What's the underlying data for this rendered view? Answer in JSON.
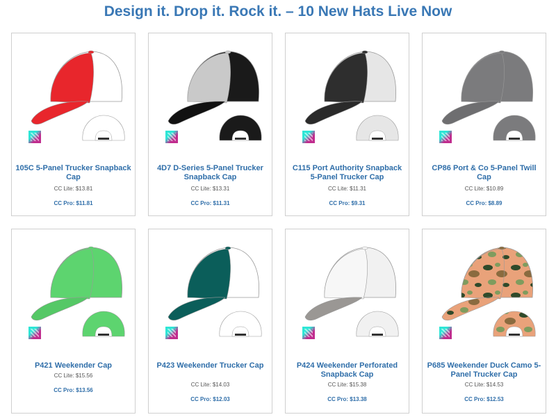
{
  "page": {
    "title": "Design it. Drop it. Rock it. – 10 New Hats Live Now"
  },
  "products": [
    {
      "name": "105C 5-Panel Trucker Snapback Cap",
      "lite": "CC Lite: $13.81",
      "pro": "CC Pro: $11.81",
      "front_color": "#e8262c",
      "mesh_color": "#ffffff",
      "brim_color": "#e8262c"
    },
    {
      "name": "4D7 D-Series 5-Panel Trucker Snapback Cap",
      "lite": "CC Lite: $13.31",
      "pro": "CC Pro: $11.31",
      "front_color": "#c9c9c9",
      "mesh_color": "#1a1a1a",
      "brim_color": "#111111"
    },
    {
      "name": "C115 Port Authority Snapback 5-Panel Trucker Cap",
      "lite": "CC Lite: $11.31",
      "pro": "CC Pro: $9.31",
      "front_color": "#2e2e2e",
      "mesh_color": "#e6e6e6",
      "brim_color": "#2a2a2a"
    },
    {
      "name": "CP86 Port & Co 5-Panel Twill Cap",
      "lite": "CC Lite: $10.89",
      "pro": "CC Pro: $8.89",
      "front_color": "#7b7b7d",
      "mesh_color": "#7b7b7d",
      "brim_color": "#6e6e70"
    },
    {
      "name": "P421 Weekender Cap",
      "lite": "CC Lite: $15.56",
      "pro": "CC Pro: $13.56",
      "front_color": "#5dd46f",
      "mesh_color": "#5dd46f",
      "brim_color": "#55c866"
    },
    {
      "name": "P423 Weekender Trucker Cap",
      "lite": "CC Lite: $14.03",
      "pro": "CC Pro: $12.03",
      "front_color": "#0b5e5a",
      "mesh_color": "#ffffff",
      "brim_color": "#0b5e5a"
    },
    {
      "name": "P424 Weekender Perforated Snapback Cap",
      "lite": "CC Lite: $15.38",
      "pro": "CC Pro: $13.38",
      "front_color": "#f7f7f7",
      "mesh_color": "#f1f1f1",
      "brim_color": "#9a9794"
    },
    {
      "name": "P685 Weekender Duck Camo 5-Panel Trucker Cap",
      "lite": "CC Lite: $14.53",
      "pro": "CC Pro: $12.53",
      "front_color": "#e9a27a",
      "mesh_color": "#e9a27a",
      "brim_color": "#e39a73"
    }
  ]
}
